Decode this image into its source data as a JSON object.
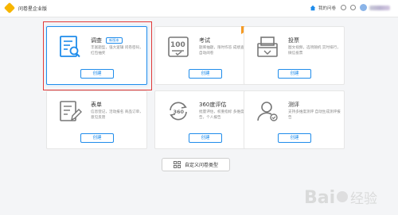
{
  "header": {
    "brand": "问卷星企业版",
    "nav_link": "我的问卷"
  },
  "cards": [
    {
      "title": "调查",
      "tag": "新版本",
      "desc": "丰富题型，强大逻辑 问卷密码，红包抽奖",
      "button": "创建",
      "icon": "survey-icon"
    },
    {
      "title": "考试",
      "desc": "题库抽题，限时作答 成绩查询，自动阅卷",
      "button": "创建",
      "icon": "exam-icon"
    },
    {
      "title": "投票",
      "desc": "图文视频，选项随机 实时排行，微信投票",
      "button": "创建",
      "icon": "ballot-box-icon"
    },
    {
      "title": "表单",
      "desc": "信息登记，活动报名 商品订单，意见反馈",
      "button": "创建",
      "icon": "form-edit-icon"
    },
    {
      "title": "360度评估",
      "desc": "批量评估，权重指标 多维度报告，个人报告",
      "button": "创建",
      "icon": "rotate-360-icon"
    },
    {
      "title": "测评",
      "desc": "支持多维度测评 自动生成测评报告",
      "button": "创建",
      "icon": "person-assessment-icon"
    }
  ],
  "custom_button": "自定义问卷类型",
  "watermark": "Baidu 经验",
  "colors": {
    "accent": "#1f8ceb",
    "highlight": "#e13a3a",
    "ribbon": "#f59a23"
  }
}
